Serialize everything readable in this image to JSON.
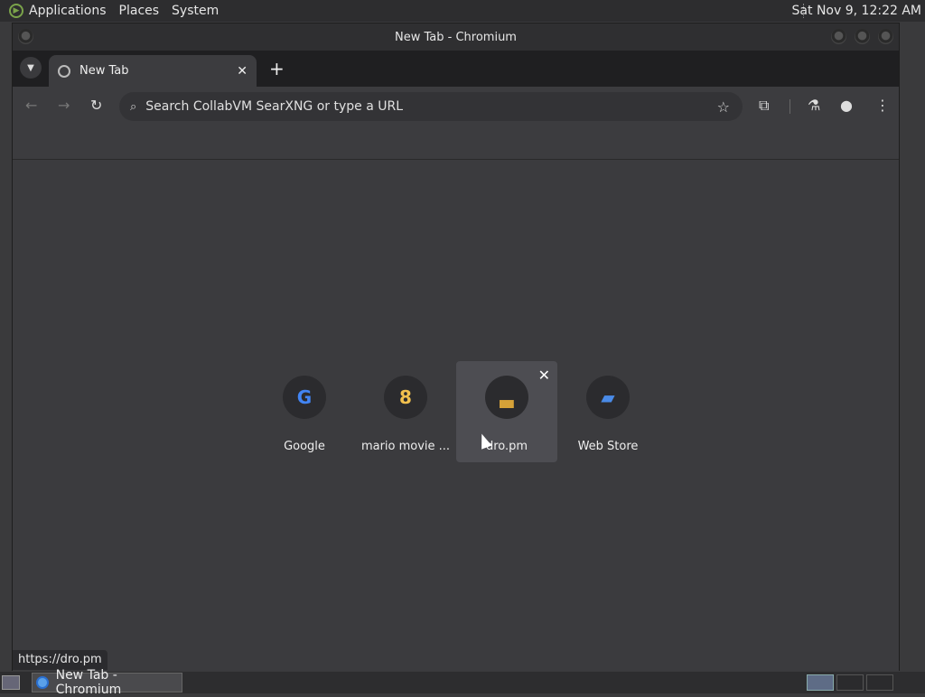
{
  "top_panel": {
    "menus": [
      "Applications",
      "Places",
      "System"
    ],
    "clock": "Sat Nov  9, 12:22 AM"
  },
  "window": {
    "title": "New Tab - Chromium"
  },
  "tabs": [
    {
      "title": "New Tab",
      "close": "✕"
    }
  ],
  "new_tab_button": "+",
  "toolbar": {
    "back": "←",
    "forward": "→",
    "reload": "↻",
    "search_icon": "⌕",
    "omnibox_placeholder": "Search CollabVM SearXNG or type a URL",
    "bookmark_star": "☆",
    "extensions_icon": "extensions-icon",
    "labs_icon": "labs-icon",
    "profile_icon": "profile-icon",
    "menu_icon": "⋮"
  },
  "shortcuts": [
    {
      "label": "Google",
      "icon": "G",
      "icon_color": "#4285f4"
    },
    {
      "label": "mario movie ...",
      "icon": "8",
      "icon_color": "#f2c14e"
    },
    {
      "label": "dro.pm",
      "icon": "▃",
      "icon_color": "#d6a238",
      "hover_close": "✕"
    },
    {
      "label": "Web Store",
      "icon": "▰",
      "icon_color": "#4a8be8"
    }
  ],
  "status_url": "https://dro.pm",
  "taskbar": {
    "task_label": "New Tab - Chromium"
  }
}
